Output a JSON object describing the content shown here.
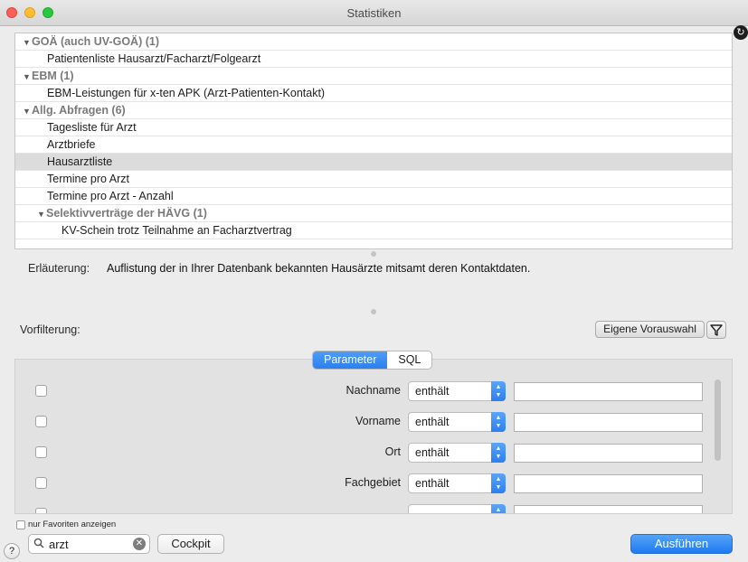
{
  "window": {
    "title": "Statistiken"
  },
  "tree": {
    "rows": [
      {
        "kind": "group",
        "label": "GOÄ (auch UV-GOÄ) (1)"
      },
      {
        "kind": "item",
        "label": "Patientenliste Hausarzt/Facharzt/Folgearzt"
      },
      {
        "kind": "group",
        "label": "EBM (1)"
      },
      {
        "kind": "item",
        "label": "EBM-Leistungen für x-ten APK (Arzt-Patienten-Kontakt)"
      },
      {
        "kind": "group",
        "label": "Allg. Abfragen (6)"
      },
      {
        "kind": "item",
        "label": "Tagesliste für Arzt"
      },
      {
        "kind": "item",
        "label": "Arztbriefe"
      },
      {
        "kind": "item",
        "label": "Hausarztliste",
        "selected": true
      },
      {
        "kind": "item",
        "label": "Termine pro Arzt"
      },
      {
        "kind": "item",
        "label": "Termine pro Arzt - Anzahl"
      },
      {
        "kind": "subgroup",
        "label": "Selektivverträge der HÄVG (1)"
      },
      {
        "kind": "subitem",
        "label": "KV-Schein trotz Teilnahme an Facharztvertrag"
      }
    ]
  },
  "explanation": {
    "label": "Erläuterung:",
    "text": "Auflistung der in Ihrer Datenbank bekannten Hausärzte mitsamt deren Kontaktdaten."
  },
  "prefilter": {
    "label": "Vorfilterung:",
    "own_selection_button": "Eigene Vorauswahl"
  },
  "tabs": {
    "parameter": "Parameter",
    "sql": "SQL"
  },
  "parameters": [
    {
      "label": "Nachname",
      "operator": "enthält",
      "value": ""
    },
    {
      "label": "Vorname",
      "operator": "enthält",
      "value": ""
    },
    {
      "label": "Ort",
      "operator": "enthält",
      "value": ""
    },
    {
      "label": "Fachgebiet",
      "operator": "enthält",
      "value": ""
    }
  ],
  "footer": {
    "favorites_only": "nur Favoriten anzeigen",
    "help": "?",
    "search_value": "arzt",
    "cockpit_button": "Cockpit",
    "run_button": "Ausführen"
  }
}
